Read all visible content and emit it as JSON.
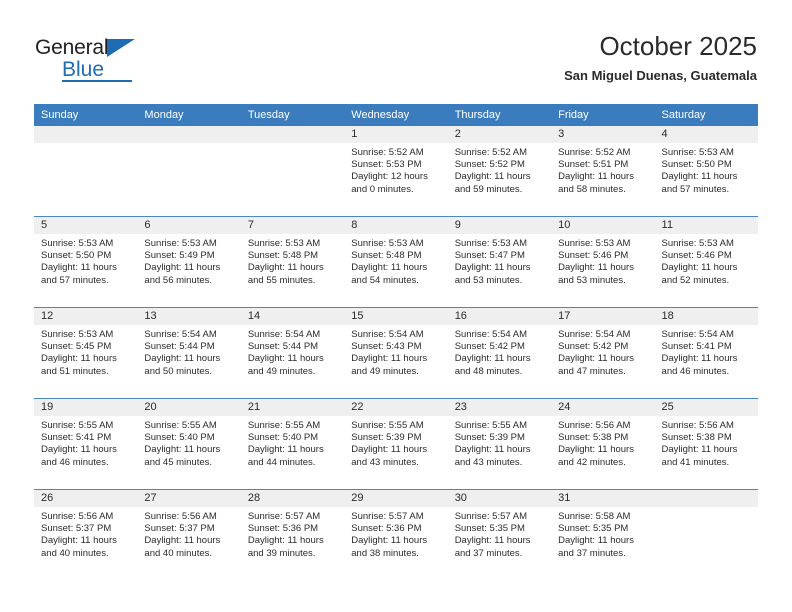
{
  "brand": {
    "name_part1": "General",
    "name_part2": "Blue",
    "accent_color": "#1f6cb4"
  },
  "header": {
    "title": "October 2025",
    "subtitle": "San Miguel Duenas, Guatemala"
  },
  "calendar": {
    "header_color": "#3a7cbe",
    "daynum_band_color": "#efefef",
    "weekday_headers": [
      "Sunday",
      "Monday",
      "Tuesday",
      "Wednesday",
      "Thursday",
      "Friday",
      "Saturday"
    ],
    "weeks": [
      [
        {
          "day": "",
          "sunrise": "",
          "sunset": "",
          "daylight_line1": "",
          "daylight_line2": ""
        },
        {
          "day": "",
          "sunrise": "",
          "sunset": "",
          "daylight_line1": "",
          "daylight_line2": ""
        },
        {
          "day": "",
          "sunrise": "",
          "sunset": "",
          "daylight_line1": "",
          "daylight_line2": ""
        },
        {
          "day": "1",
          "sunrise": "Sunrise: 5:52 AM",
          "sunset": "Sunset: 5:53 PM",
          "daylight_line1": "Daylight: 12 hours",
          "daylight_line2": "and 0 minutes."
        },
        {
          "day": "2",
          "sunrise": "Sunrise: 5:52 AM",
          "sunset": "Sunset: 5:52 PM",
          "daylight_line1": "Daylight: 11 hours",
          "daylight_line2": "and 59 minutes."
        },
        {
          "day": "3",
          "sunrise": "Sunrise: 5:52 AM",
          "sunset": "Sunset: 5:51 PM",
          "daylight_line1": "Daylight: 11 hours",
          "daylight_line2": "and 58 minutes."
        },
        {
          "day": "4",
          "sunrise": "Sunrise: 5:53 AM",
          "sunset": "Sunset: 5:50 PM",
          "daylight_line1": "Daylight: 11 hours",
          "daylight_line2": "and 57 minutes."
        }
      ],
      [
        {
          "day": "5",
          "sunrise": "Sunrise: 5:53 AM",
          "sunset": "Sunset: 5:50 PM",
          "daylight_line1": "Daylight: 11 hours",
          "daylight_line2": "and 57 minutes."
        },
        {
          "day": "6",
          "sunrise": "Sunrise: 5:53 AM",
          "sunset": "Sunset: 5:49 PM",
          "daylight_line1": "Daylight: 11 hours",
          "daylight_line2": "and 56 minutes."
        },
        {
          "day": "7",
          "sunrise": "Sunrise: 5:53 AM",
          "sunset": "Sunset: 5:48 PM",
          "daylight_line1": "Daylight: 11 hours",
          "daylight_line2": "and 55 minutes."
        },
        {
          "day": "8",
          "sunrise": "Sunrise: 5:53 AM",
          "sunset": "Sunset: 5:48 PM",
          "daylight_line1": "Daylight: 11 hours",
          "daylight_line2": "and 54 minutes."
        },
        {
          "day": "9",
          "sunrise": "Sunrise: 5:53 AM",
          "sunset": "Sunset: 5:47 PM",
          "daylight_line1": "Daylight: 11 hours",
          "daylight_line2": "and 53 minutes."
        },
        {
          "day": "10",
          "sunrise": "Sunrise: 5:53 AM",
          "sunset": "Sunset: 5:46 PM",
          "daylight_line1": "Daylight: 11 hours",
          "daylight_line2": "and 53 minutes."
        },
        {
          "day": "11",
          "sunrise": "Sunrise: 5:53 AM",
          "sunset": "Sunset: 5:46 PM",
          "daylight_line1": "Daylight: 11 hours",
          "daylight_line2": "and 52 minutes."
        }
      ],
      [
        {
          "day": "12",
          "sunrise": "Sunrise: 5:53 AM",
          "sunset": "Sunset: 5:45 PM",
          "daylight_line1": "Daylight: 11 hours",
          "daylight_line2": "and 51 minutes."
        },
        {
          "day": "13",
          "sunrise": "Sunrise: 5:54 AM",
          "sunset": "Sunset: 5:44 PM",
          "daylight_line1": "Daylight: 11 hours",
          "daylight_line2": "and 50 minutes."
        },
        {
          "day": "14",
          "sunrise": "Sunrise: 5:54 AM",
          "sunset": "Sunset: 5:44 PM",
          "daylight_line1": "Daylight: 11 hours",
          "daylight_line2": "and 49 minutes."
        },
        {
          "day": "15",
          "sunrise": "Sunrise: 5:54 AM",
          "sunset": "Sunset: 5:43 PM",
          "daylight_line1": "Daylight: 11 hours",
          "daylight_line2": "and 49 minutes."
        },
        {
          "day": "16",
          "sunrise": "Sunrise: 5:54 AM",
          "sunset": "Sunset: 5:42 PM",
          "daylight_line1": "Daylight: 11 hours",
          "daylight_line2": "and 48 minutes."
        },
        {
          "day": "17",
          "sunrise": "Sunrise: 5:54 AM",
          "sunset": "Sunset: 5:42 PM",
          "daylight_line1": "Daylight: 11 hours",
          "daylight_line2": "and 47 minutes."
        },
        {
          "day": "18",
          "sunrise": "Sunrise: 5:54 AM",
          "sunset": "Sunset: 5:41 PM",
          "daylight_line1": "Daylight: 11 hours",
          "daylight_line2": "and 46 minutes."
        }
      ],
      [
        {
          "day": "19",
          "sunrise": "Sunrise: 5:55 AM",
          "sunset": "Sunset: 5:41 PM",
          "daylight_line1": "Daylight: 11 hours",
          "daylight_line2": "and 46 minutes."
        },
        {
          "day": "20",
          "sunrise": "Sunrise: 5:55 AM",
          "sunset": "Sunset: 5:40 PM",
          "daylight_line1": "Daylight: 11 hours",
          "daylight_line2": "and 45 minutes."
        },
        {
          "day": "21",
          "sunrise": "Sunrise: 5:55 AM",
          "sunset": "Sunset: 5:40 PM",
          "daylight_line1": "Daylight: 11 hours",
          "daylight_line2": "and 44 minutes."
        },
        {
          "day": "22",
          "sunrise": "Sunrise: 5:55 AM",
          "sunset": "Sunset: 5:39 PM",
          "daylight_line1": "Daylight: 11 hours",
          "daylight_line2": "and 43 minutes."
        },
        {
          "day": "23",
          "sunrise": "Sunrise: 5:55 AM",
          "sunset": "Sunset: 5:39 PM",
          "daylight_line1": "Daylight: 11 hours",
          "daylight_line2": "and 43 minutes."
        },
        {
          "day": "24",
          "sunrise": "Sunrise: 5:56 AM",
          "sunset": "Sunset: 5:38 PM",
          "daylight_line1": "Daylight: 11 hours",
          "daylight_line2": "and 42 minutes."
        },
        {
          "day": "25",
          "sunrise": "Sunrise: 5:56 AM",
          "sunset": "Sunset: 5:38 PM",
          "daylight_line1": "Daylight: 11 hours",
          "daylight_line2": "and 41 minutes."
        }
      ],
      [
        {
          "day": "26",
          "sunrise": "Sunrise: 5:56 AM",
          "sunset": "Sunset: 5:37 PM",
          "daylight_line1": "Daylight: 11 hours",
          "daylight_line2": "and 40 minutes."
        },
        {
          "day": "27",
          "sunrise": "Sunrise: 5:56 AM",
          "sunset": "Sunset: 5:37 PM",
          "daylight_line1": "Daylight: 11 hours",
          "daylight_line2": "and 40 minutes."
        },
        {
          "day": "28",
          "sunrise": "Sunrise: 5:57 AM",
          "sunset": "Sunset: 5:36 PM",
          "daylight_line1": "Daylight: 11 hours",
          "daylight_line2": "and 39 minutes."
        },
        {
          "day": "29",
          "sunrise": "Sunrise: 5:57 AM",
          "sunset": "Sunset: 5:36 PM",
          "daylight_line1": "Daylight: 11 hours",
          "daylight_line2": "and 38 minutes."
        },
        {
          "day": "30",
          "sunrise": "Sunrise: 5:57 AM",
          "sunset": "Sunset: 5:35 PM",
          "daylight_line1": "Daylight: 11 hours",
          "daylight_line2": "and 37 minutes."
        },
        {
          "day": "31",
          "sunrise": "Sunrise: 5:58 AM",
          "sunset": "Sunset: 5:35 PM",
          "daylight_line1": "Daylight: 11 hours",
          "daylight_line2": "and 37 minutes."
        },
        {
          "day": "",
          "sunrise": "",
          "sunset": "",
          "daylight_line1": "",
          "daylight_line2": ""
        }
      ]
    ]
  }
}
